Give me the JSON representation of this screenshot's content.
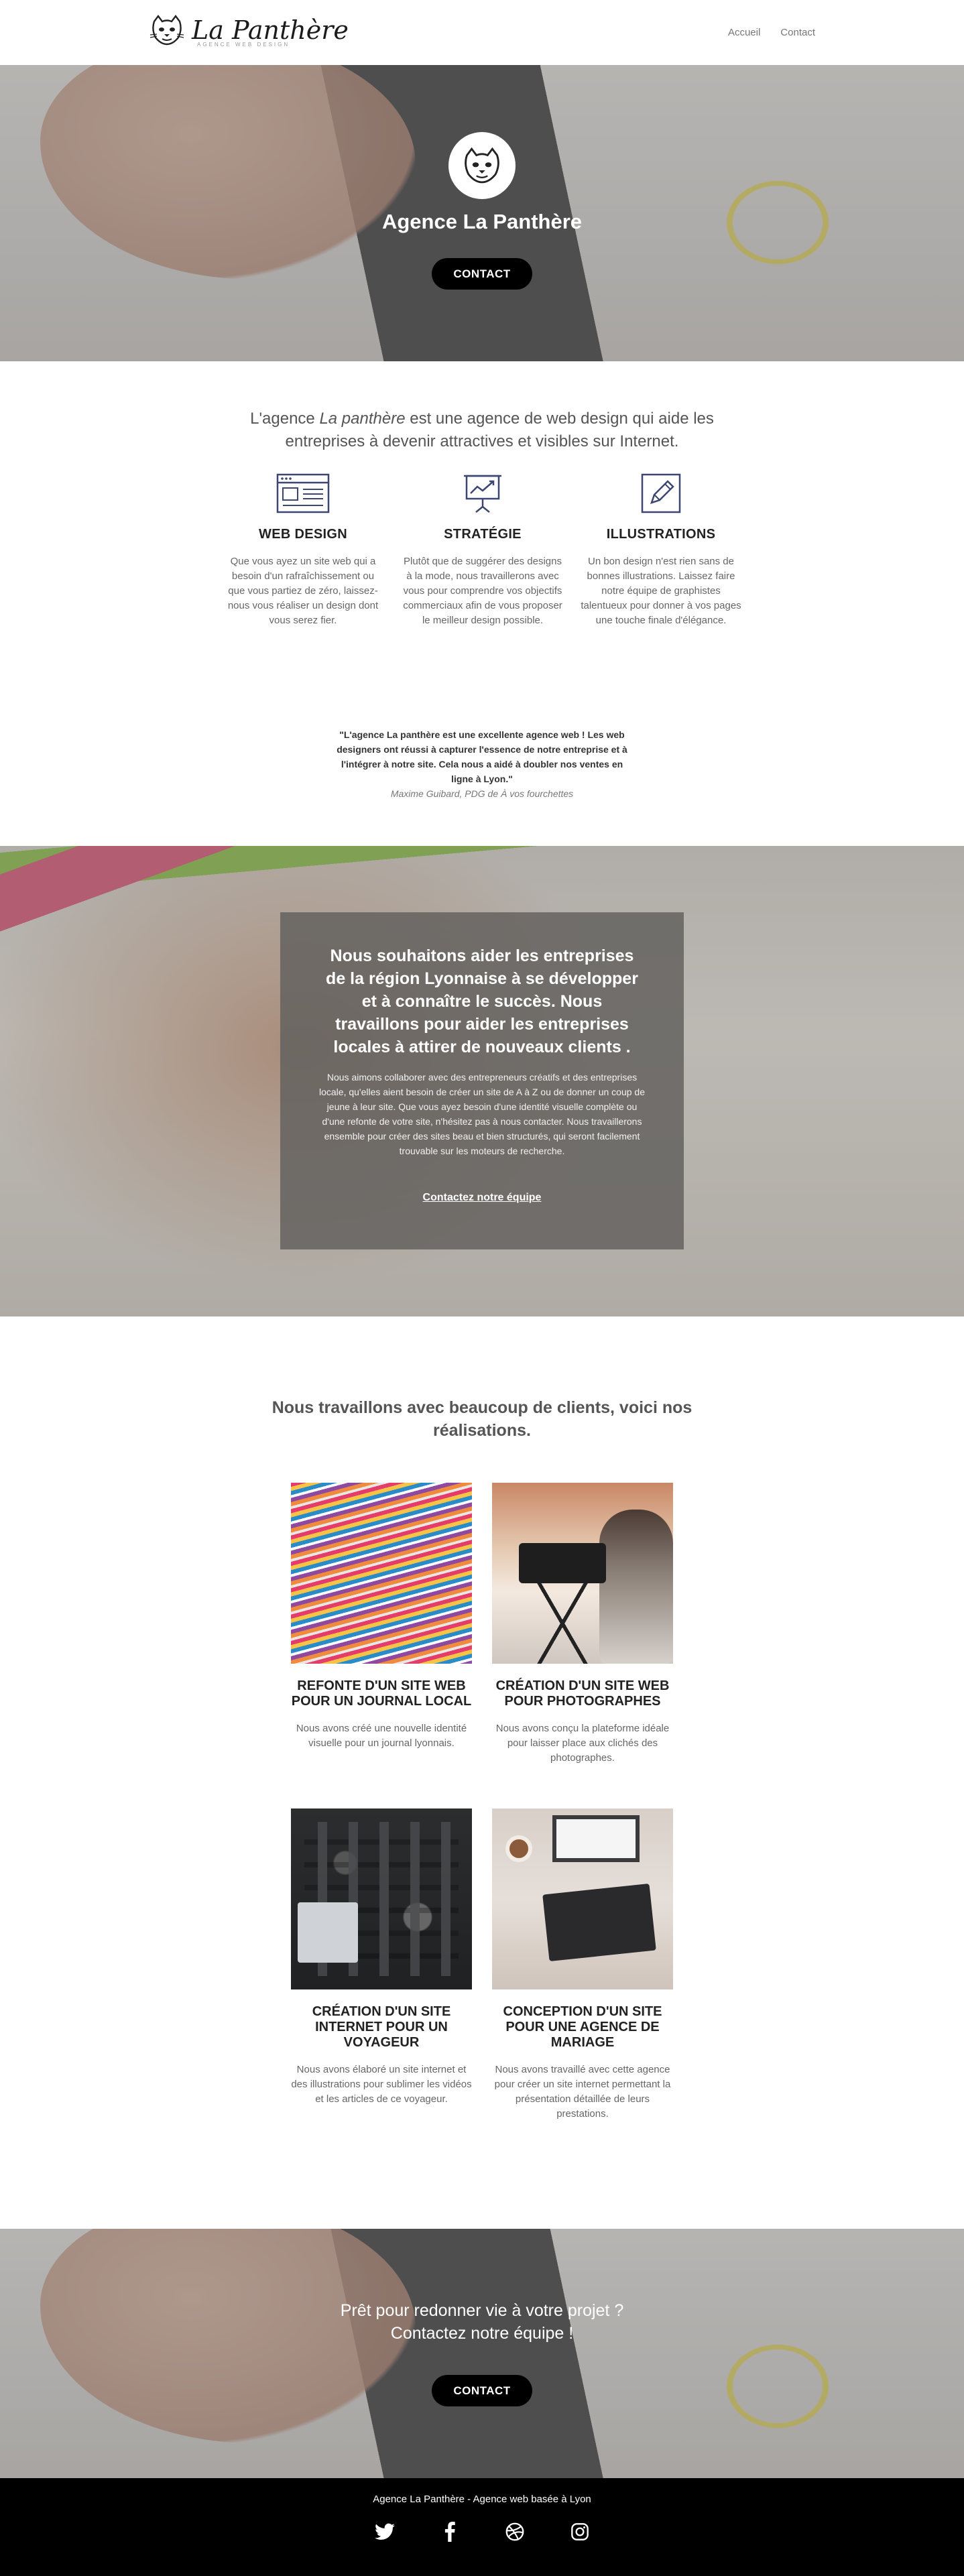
{
  "header": {
    "logo_text": "La Panthère",
    "logo_subtitle": "AGENCE WEB DESIGN",
    "nav": [
      {
        "label": "Accueil"
      },
      {
        "label": "Contact"
      }
    ]
  },
  "hero": {
    "title": "Agence La Panthère",
    "button": "CONTACT"
  },
  "intro": {
    "before": "L'agence ",
    "brand": "La panthère",
    "after": " est une agence de web design qui aide les entreprises à devenir attractives et visibles sur Internet."
  },
  "features": [
    {
      "icon": "browser-window-icon",
      "title": "WEB DESIGN",
      "description": "Que vous ayez un site web qui a besoin d'un rafraîchissement ou que vous partiez de zéro, laissez-nous vous réaliser un design dont vous serez fier."
    },
    {
      "icon": "presentation-chart-icon",
      "title": "STRATÉGIE",
      "description": "Plutôt que de suggérer des designs à la mode, nous travaillerons avec vous pour comprendre vos objectifs commerciaux afin de vous proposer le meilleur design possible."
    },
    {
      "icon": "pencil-icon",
      "title": "ILLUSTRATIONS",
      "description": "Un bon design n'est rien sans de bonnes illustrations. Laissez faire notre équipe de graphistes talentueux pour donner à vos pages une touche finale d'élégance."
    }
  ],
  "testimonial": {
    "quote": "\"L'agence La panthère est une excellente agence web ! Les web designers ont réussi à capturer l'essence de notre entreprise et à l'intégrer à notre site. Cela nous a aidé à doubler nos ventes en ligne à Lyon.\"",
    "author": "Maxime Guibard, PDG de À vos fourchettes"
  },
  "mission": {
    "title": "Nous souhaitons aider les entreprises de la région Lyonnaise à se développer et à connaître le succès. Nous travaillons pour aider les entreprises locales à attirer de nouveaux clients .",
    "text": "Nous aimons collaborer avec des entrepreneurs créatifs et des entreprises locale, qu'elles aient besoin de créer un site de A à Z ou de donner un coup de jeune à leur site. Que vous ayez besoin d'une identité visuelle complète ou d'une refonte de votre site, n'hésitez pas à nous contacter. Nous travaillerons ensemble pour créer des sites beau et bien structurés, qui seront facilement trouvable sur les moteurs de recherche.",
    "link": "Contactez notre équipe"
  },
  "work": {
    "title": "Nous travaillons avec beaucoup de clients, voici nos réalisations.",
    "projects": [
      {
        "title": "REFONTE D'UN SITE WEB POUR UN JOURNAL LOCAL",
        "description": "Nous avons créé une nouvelle identité visuelle pour un journal lyonnais."
      },
      {
        "title": "CRÉATION D'UN SITE WEB POUR PHOTOGRAPHES",
        "description": "Nous avons conçu la plateforme idéale pour laisser place aux clichés des photographes."
      },
      {
        "title": "CRÉATION D'UN SITE INTERNET POUR UN VOYAGEUR",
        "description": "Nous avons élaboré un site internet et des illustrations pour sublimer les vidéos et les articles de ce voyageur."
      },
      {
        "title": "CONCEPTION D'UN SITE POUR UNE AGENCE DE MARIAGE",
        "description": "Nous avons travaillé avec cette agence pour créer un site internet permettant la présentation détaillée de leurs prestations."
      }
    ]
  },
  "cta": {
    "line1": "Prêt pour redonner vie à votre projet ?",
    "line2": "Contactez notre équipe !",
    "button": "CONTACT"
  },
  "footer": {
    "text": "Agence La Panthère - Agence web basée à Lyon",
    "socials": [
      "twitter-icon",
      "facebook-icon",
      "dribbble-icon",
      "instagram-icon"
    ]
  },
  "colors": {
    "accent": "#000000",
    "icon_stroke": "#3d4670"
  }
}
